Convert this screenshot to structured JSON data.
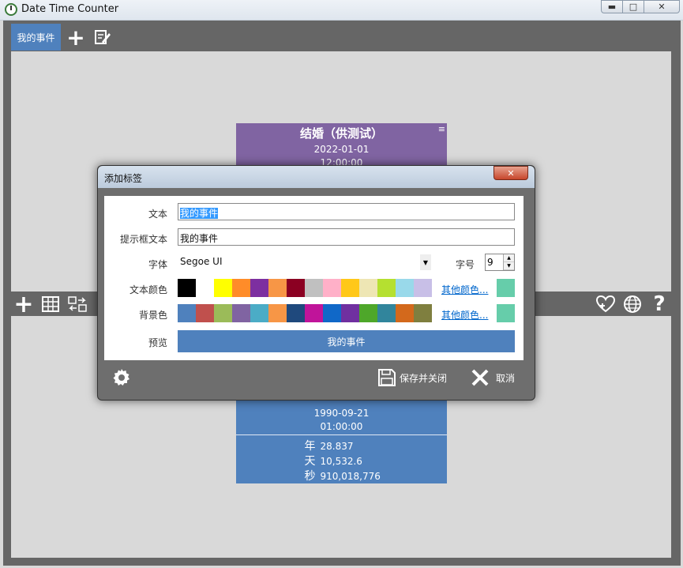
{
  "app": {
    "title": "Date Time Counter"
  },
  "tabs": [
    {
      "label": "我的事件"
    }
  ],
  "event_top": {
    "title": "结婚（供测试）",
    "date": "2022-01-01",
    "time": "12:00:00"
  },
  "event_bottom": {
    "date": "1990-09-21",
    "time": "01:00:00",
    "stats": [
      {
        "unit": "年",
        "value": "28.837"
      },
      {
        "unit": "天",
        "value": "10,532.6"
      },
      {
        "unit": "秒",
        "value": "910,018,776"
      }
    ]
  },
  "dialog": {
    "title": "添加标签",
    "text_label": "文本",
    "text_value": "我的事件",
    "tooltip_label": "提示框文本",
    "tooltip_value": "我的事件",
    "font_label": "字体",
    "font_value": "Segoe UI",
    "size_label": "字号",
    "size_value": "9",
    "text_color_label": "文本颜色",
    "bg_color_label": "背景色",
    "more_colors": "其他颜色...",
    "preview_label": "预览",
    "preview_text": "我的事件",
    "save_label": "保存并关闭",
    "cancel_label": "取消",
    "text_colors": [
      "#000000",
      "#ffffff",
      "#ffff00",
      "#ff8c29",
      "#7d2fa0",
      "#f79646",
      "#8b0022",
      "#c0c0c0",
      "#ffb0c8",
      "#ffc819",
      "#eee6b4",
      "#b5e030",
      "#99d9ea",
      "#c8bfe7"
    ],
    "text_color_selected": "#66cdaa",
    "bg_colors": [
      "#4f81bd",
      "#c0504d",
      "#9bbb59",
      "#8064a2",
      "#4bacc6",
      "#f79646",
      "#1f497d",
      "#c0149a",
      "#1068c8",
      "#7030a0",
      "#4ea72a",
      "#31859c",
      "#d3691c",
      "#7f7f3f"
    ],
    "bg_color_selected": "#66cdaa"
  }
}
